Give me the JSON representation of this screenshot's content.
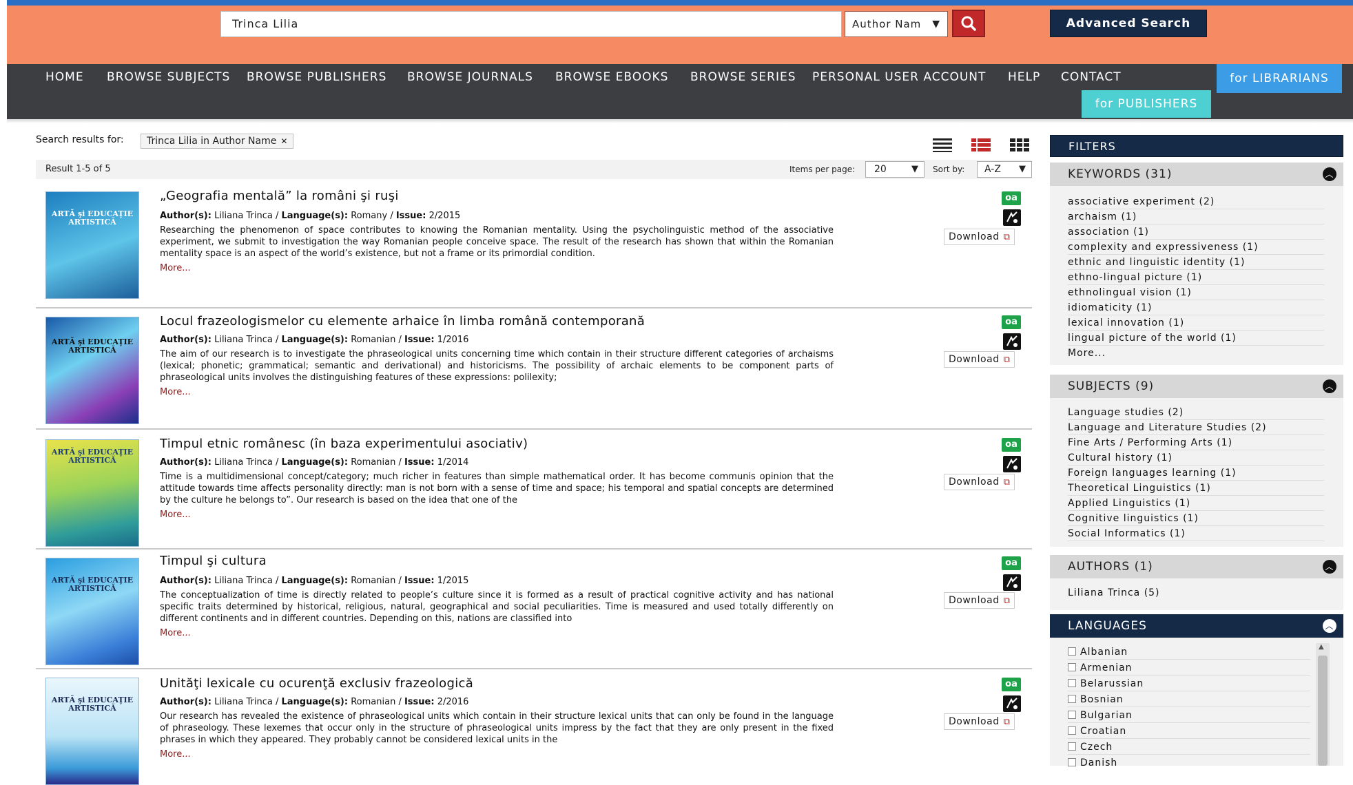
{
  "header": {
    "search_value": "Trinca Lilia",
    "search_type": "Author Nam",
    "advanced_search_label": "Advanced Search"
  },
  "nav": {
    "items": [
      "HOME",
      "BROWSE SUBJECTS",
      "BROWSE PUBLISHERS",
      "BROWSE JOURNALS",
      "BROWSE EBOOKS",
      "BROWSE SERIES",
      "PERSONAL USER ACCOUNT",
      "HELP",
      "CONTACT"
    ],
    "librarians_label": "for LIBRARIANS",
    "publishers_label": "for PUBLISHERS"
  },
  "search": {
    "results_for_label": "Search results for:",
    "filter_chip": "Trinca Lilia in Author Name",
    "result_count": "Result 1-5 of 5",
    "items_per_page_label": "Items per page:",
    "items_per_page_value": "20",
    "sort_label": "Sort by:",
    "sort_value": "A-Z"
  },
  "results": [
    {
      "title": "„Geografia mentală” la români şi ruşi",
      "authors_label": "Author(s):",
      "authors": "Liliana Trinca",
      "language_label": "Language(s):",
      "language": "Romany",
      "issue_label": "Issue:",
      "issue": "2/2015",
      "abstract": "Researching the phenomenon of space contributes to knowing the Romanian mentality. Using the psycholinguistic method of the associative experiment, we submit to investigation the way Romanian people conceive space. The result of the research has shown that within the Romanian mentality space is an aspect of the world’s existence, but not a frame or its primordial condition.",
      "more": "More...",
      "oa": "oa",
      "download": "Download",
      "cover_title": "ARTĂ şi EDUCAŢIE ARTISTICĂ"
    },
    {
      "title": "Locul frazeologismelor cu elemente arhaice în limba română contemporană",
      "authors_label": "Author(s):",
      "authors": "Liliana Trinca",
      "language_label": "Language(s):",
      "language": "Romanian",
      "issue_label": "Issue:",
      "issue": "1/2016",
      "abstract": "The aim of our research is to investigate the phraseological units concerning time which contain in their structure different categories of archaisms (lexical; phonetic; grammatical; semantic and derivational) and historicisms. The possibility of archaic elements to be component parts of phraseological units involves the distinguishing features of these expressions: polilexity;",
      "more": "More...",
      "oa": "oa",
      "download": "Download",
      "cover_title": "ARTĂ şi EDUCAŢIE ARTISTICĂ"
    },
    {
      "title": "Timpul etnic românesc (în baza experimentului asociativ)",
      "authors_label": "Author(s):",
      "authors": "Liliana Trinca",
      "language_label": "Language(s):",
      "language": "Romanian",
      "issue_label": "Issue:",
      "issue": "1/2014",
      "abstract": "Time is a multidimensional concept/category; much richer in features than simple mathematical order. It has become communis opinion that the attitude towards time affects personality directly: man is not born with a sense of time and space; his temporal and spatial concepts are determined by the culture he belongs to”. Our research is based on the idea that one of the",
      "more": "More...",
      "oa": "oa",
      "download": "Download",
      "cover_title": "ARTĂ şi EDUCAŢIE ARTISTICĂ"
    },
    {
      "title": "Timpul şi cultura",
      "authors_label": "Author(s):",
      "authors": "Liliana Trinca",
      "language_label": "Language(s):",
      "language": "Romanian",
      "issue_label": "Issue:",
      "issue": "1/2015",
      "abstract": "The conceptualization of time is directly related to people’s culture since it is formed as a result of practical cognitive activity and has national specific traits determined by historical, religious, natural, geographical and social peculiarities. Time is measured and used totally differently on different continents and in different countries. Depending on this, nations are classified into",
      "more": "More...",
      "oa": "oa",
      "download": "Download",
      "cover_title": "ARTĂ şi EDUCAŢIE ARTISTICĂ"
    },
    {
      "title": "Unităţi lexicale cu ocurenţă exclusiv frazeologică",
      "authors_label": "Author(s):",
      "authors": "Liliana Trinca",
      "language_label": "Language(s):",
      "language": "Romanian",
      "issue_label": "Issue:",
      "issue": "2/2016",
      "abstract": "Our research has revealed the existence of phraseological units which contain in their structure lexical units that can only be found in the language of phraseology. These lexemes that occur only in the structure of phraseological units impress by the fact that they are only present in the fixed phrases in which they appeared. They probably cannot be considered lexical units in the",
      "more": "More...",
      "oa": "oa",
      "download": "Download",
      "cover_title": "ARTĂ şi EDUCAŢIE ARTISTICĂ"
    }
  ],
  "sidebar": {
    "filters_title": "FILTERS",
    "keywords": {
      "title": "KEYWORDS (31)",
      "items": [
        "associative experiment (2)",
        "archaism (1)",
        "association (1)",
        "complexity and expressiveness (1)",
        "ethnic and linguistic identity (1)",
        "ethno-lingual picture (1)",
        "ethnolingual vision (1)",
        "idiomaticity (1)",
        "lexical innovation (1)",
        "lingual picture of the world (1)"
      ],
      "more": "More..."
    },
    "subjects": {
      "title": "SUBJECTS (9)",
      "items": [
        "Language studies (2)",
        "Language and Literature Studies (2)",
        "Fine Arts / Performing Arts (1)",
        "Cultural history (1)",
        "Foreign languages learning (1)",
        "Theoretical Linguistics (1)",
        "Applied Linguistics (1)",
        "Cognitive linguistics (1)",
        "Social Informatics (1)"
      ]
    },
    "authors": {
      "title": "AUTHORS (1)",
      "items": [
        "Liliana Trinca (5)"
      ]
    },
    "languages": {
      "title": "LANGUAGES",
      "items": [
        "Albanian",
        "Armenian",
        "Belarussian",
        "Bosnian",
        "Bulgarian",
        "Croatian",
        "Czech",
        "Danish"
      ]
    }
  },
  "colors": {
    "header_orange": "#f58a63",
    "nav_dark": "#3c3e42",
    "navy": "#142a47",
    "librarians_blue": "#3d9ce6",
    "publishers_teal": "#4ed0d3",
    "search_red": "#c0282a",
    "oa_green": "#1ea24a"
  }
}
